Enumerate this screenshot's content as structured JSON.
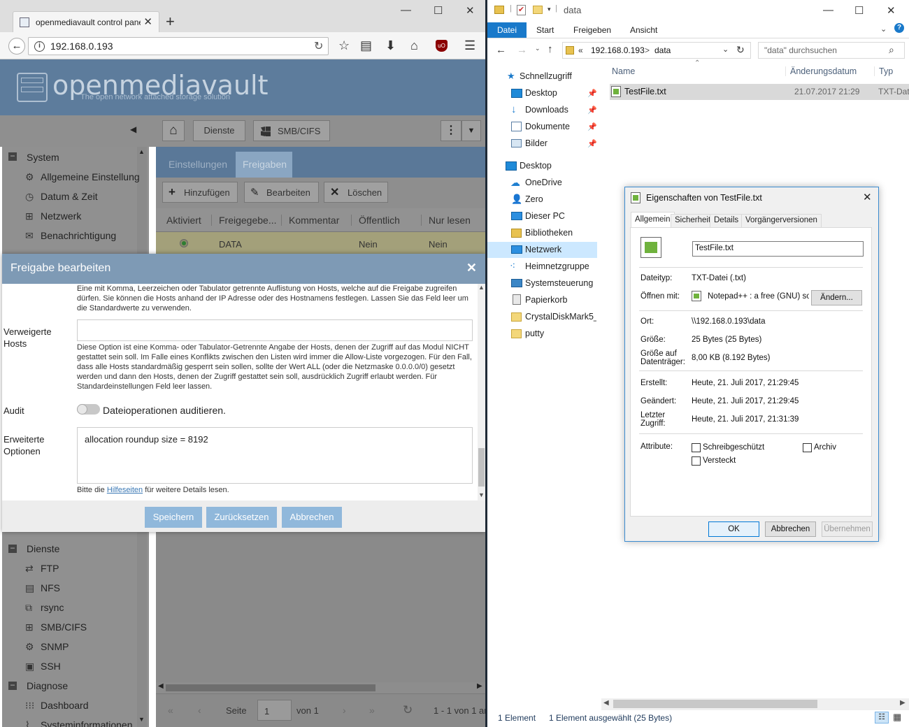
{
  "browser": {
    "tab_title": "openmediavault control panel",
    "url": "192.168.0.193",
    "logo": "openmediavault",
    "tagline": "The open network attached storage solution",
    "breadcrumb": [
      "Dienste",
      "SMB/CIFS"
    ],
    "subtabs": [
      "Einstellungen",
      "Freigaben"
    ],
    "toolbar": [
      "Hinzufügen",
      "Bearbeiten",
      "Löschen"
    ],
    "columns": [
      "Aktiviert",
      "Freigegebe...",
      "Kommentar",
      "Öffentlich",
      "Nur lesen"
    ],
    "row": {
      "name": "DATA",
      "public": "Nein",
      "readonly": "Nein"
    },
    "sidebar": {
      "system": "System",
      "system_items": [
        "Allgemeine Einstellung",
        "Datum & Zeit",
        "Netzwerk",
        "Benachrichtigung"
      ],
      "dienste": "Dienste",
      "dienste_items": [
        "FTP",
        "NFS",
        "rsync",
        "SMB/CIFS",
        "SNMP",
        "SSH"
      ],
      "diagnose": "Diagnose",
      "diagnose_items": [
        "Dashboard",
        "Systeminformationen"
      ]
    },
    "pager": {
      "page_label": "Seite",
      "page": "1",
      "of": "von 1",
      "range": "1 - 1 von 1 an"
    }
  },
  "modal": {
    "title": "Freigabe bearbeiten",
    "allowed_hint": "Eine mit Komma, Leerzeichen oder Tabulator getrennte Auflistung von Hosts, welche auf die Freigabe zugreifen dürfen. Sie können die Hosts anhand der IP Adresse oder des Hostnamens festlegen. Lassen Sie das Feld leer um die Standardwerte zu verwenden.",
    "denied_label": "Verweigerte Hosts",
    "denied_value": "",
    "denied_hint": "Diese Option ist eine Komma- oder Tabulator-Getrennte Angabe der Hosts, denen der Zugriff auf das Modul NICHT gestattet sein soll. Im Falle eines Konflikts zwischen den Listen wird immer die Allow-Liste vorgezogen. Für den Fall, dass alle Hosts standardmäßig gesperrt sein sollen, sollte der Wert ALL (oder die Netzmaske 0.0.0.0/0) gesetzt werden und dann den Hosts, denen der Zugriff gestattet sein soll, ausdrücklich Zugriff erlaubt werden. Für Standardeinstellungen Feld leer lassen.",
    "audit_label": "Audit",
    "audit_text": "Dateioperationen auditieren.",
    "audit_on": false,
    "extra_label": "Erweiterte Optionen",
    "extra_value": "allocation roundup size = 8192",
    "help_pre": "Bitte die",
    "help_link": "Hilfeseiten",
    "help_post": "für weitere Details lesen.",
    "buttons": [
      "Speichern",
      "Zurücksetzen",
      "Abbrechen"
    ]
  },
  "explorer": {
    "folder": "data",
    "ribbon_tabs": [
      "Datei",
      "Start",
      "Freigeben",
      "Ansicht"
    ],
    "address": [
      "«",
      "192.168.0.193",
      ">",
      "data"
    ],
    "search_placeholder": "\"data\" durchsuchen",
    "columns": [
      "Name",
      "Änderungsdatum",
      "Typ"
    ],
    "file": {
      "name": "TestFile.txt",
      "date": "21.07.2017 21:29",
      "type": "TXT-Datei"
    },
    "nav": {
      "quick": "Schnellzugriff",
      "quick_items": [
        "Desktop",
        "Downloads",
        "Dokumente",
        "Bilder"
      ],
      "desktop": "Desktop",
      "desktop_items": [
        "OneDrive",
        "Zero",
        "Dieser PC",
        "Bibliotheken",
        "Netzwerk",
        "Heimnetzgruppe",
        "Systemsteuerung",
        "Papierkorb",
        "CrystalDiskMark5_2_",
        "putty"
      ]
    },
    "status_count": "1 Element",
    "status_selected": "1 Element ausgewählt (25 Bytes)"
  },
  "dialog": {
    "title": "Eigenschaften von TestFile.txt",
    "tabs": [
      "Allgemein",
      "Sicherheit",
      "Details",
      "Vorgängerversionen"
    ],
    "filename": "TestFile.txt",
    "rows": [
      {
        "label": "Dateityp:",
        "value": "TXT-Datei (.txt)"
      },
      {
        "label": "Öffnen mit:",
        "value": "Notepad++ : a free (GNU) sou"
      },
      {
        "label": "Ort:",
        "value": "\\\\192.168.0.193\\data"
      },
      {
        "label": "Größe:",
        "value": "25 Bytes (25 Bytes)"
      },
      {
        "label": "Größe auf Datenträger:",
        "value": "8,00 KB (8.192 Bytes)"
      },
      {
        "label": "Erstellt:",
        "value": "Heute, 21. Juli 2017, 21:29:45"
      },
      {
        "label": "Geändert:",
        "value": "Heute, 21. Juli 2017, 21:29:45"
      },
      {
        "label": "Letzter Zugriff:",
        "value": "Heute, 21. Juli 2017, 21:31:39"
      }
    ],
    "change_btn": "Ändern...",
    "attr_label": "Attribute:",
    "attrs": [
      "Schreibgeschützt",
      "Archiv",
      "Versteckt"
    ],
    "buttons": [
      "OK",
      "Abbrechen",
      "Übernehmen"
    ]
  }
}
